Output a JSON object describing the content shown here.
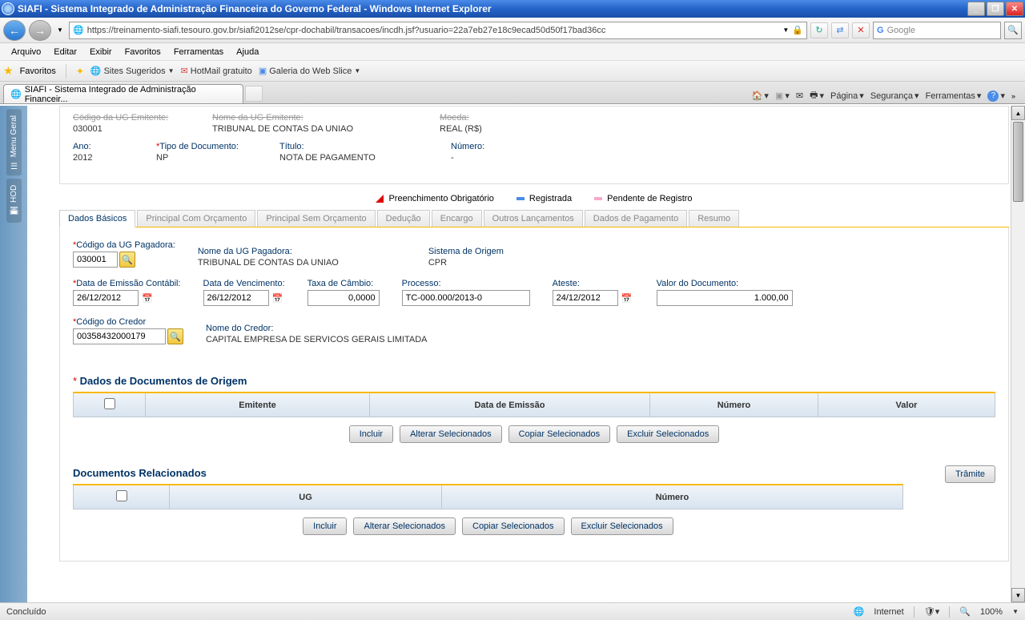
{
  "window": {
    "title": "SIAFI - Sistema Integrado de Administração Financeira do Governo Federal - Windows Internet Explorer"
  },
  "nav": {
    "url": "https://treinamento-siafi.tesouro.gov.br/siafi2012se/cpr-dochabil/transacoes/incdh.jsf?usuario=22a7eb27e18c9ecad50d50f17bad36cc",
    "search_placeholder": "Google"
  },
  "menu": {
    "arquivo": "Arquivo",
    "editar": "Editar",
    "exibir": "Exibir",
    "favoritos": "Favoritos",
    "ferramentas": "Ferramentas",
    "ajuda": "Ajuda"
  },
  "favbar": {
    "favoritos": "Favoritos",
    "sites": "Sites Sugeridos",
    "hotmail": "HotMail gratuito",
    "galeria": "Galeria do Web Slice"
  },
  "tab": {
    "title": "SIAFI - Sistema Integrado de Administração Financeir..."
  },
  "tabbar_right": {
    "pagina": "Página",
    "seguranca": "Segurança",
    "ferramentas": "Ferramentas"
  },
  "side": {
    "menu": "Menu Geral",
    "hod": "HOD"
  },
  "header": {
    "codigo_ug_label": "Código da UG Emitente:",
    "codigo_ug": "030001",
    "nome_ug_label": "Nome da UG Emitente:",
    "nome_ug": "TRIBUNAL DE CONTAS DA UNIAO",
    "moeda_label": "Moeda:",
    "moeda": "REAL (R$)",
    "ano_label": "Ano:",
    "ano": "2012",
    "tipo_label": "Tipo de Documento:",
    "tipo": "NP",
    "titulo_label": "Título:",
    "titulo": "NOTA DE PAGAMENTO",
    "numero_label": "Número:",
    "numero": "-"
  },
  "legend": {
    "obrig": "Preenchimento Obrigatório",
    "reg": "Registrada",
    "pend": "Pendente de Registro"
  },
  "apptabs": {
    "t0": "Dados Básicos",
    "t1": "Principal Com Orçamento",
    "t2": "Principal Sem Orçamento",
    "t3": "Dedução",
    "t4": "Encargo",
    "t5": "Outros Lançamentos",
    "t6": "Dados de Pagamento",
    "t7": "Resumo"
  },
  "form": {
    "cod_ug_pag_label": "Código da UG Pagadora:",
    "cod_ug_pag": "030001",
    "nome_ug_pag_label": "Nome da UG Pagadora:",
    "nome_ug_pag": "TRIBUNAL DE CONTAS DA UNIAO",
    "sistema_label": "Sistema de Origem",
    "sistema": "CPR",
    "data_emissao_label": "Data de Emissão Contábil:",
    "data_emissao": "26/12/2012",
    "data_venc_label": "Data de Vencimento:",
    "data_venc": "26/12/2012",
    "taxa_label": "Taxa de Câmbio:",
    "taxa": "0,0000",
    "processo_label": "Processo:",
    "processo": "TC-000.000/2013-0",
    "ateste_label": "Ateste:",
    "ateste": "24/12/2012",
    "valor_doc_label": "Valor do Documento:",
    "valor_doc": "1.000,00",
    "cod_credor_label": "Código do Credor",
    "cod_credor": "00358432000179",
    "nome_credor_label": "Nome do Credor:",
    "nome_credor": "CAPITAL EMPRESA DE SERVICOS GERAIS LIMITADA"
  },
  "sec1": {
    "title": "Dados de Documentos de Origem",
    "col_emitente": "Emitente",
    "col_data": "Data de Emissão",
    "col_numero": "Número",
    "col_valor": "Valor"
  },
  "sec2": {
    "title": "Documentos Relacionados",
    "col_ug": "UG",
    "col_numero": "Número"
  },
  "buttons": {
    "incluir": "Incluir",
    "alterar": "Alterar Selecionados",
    "copiar": "Copiar Selecionados",
    "excluir": "Excluir Selecionados",
    "tramite": "Trâmite"
  },
  "status": {
    "left": "Concluído",
    "internet": "Internet",
    "zoom": "100%"
  }
}
